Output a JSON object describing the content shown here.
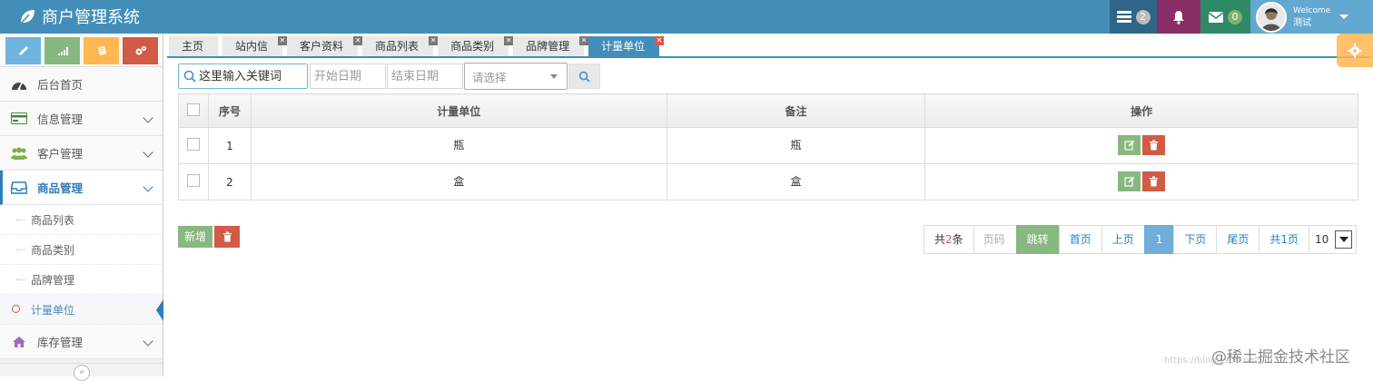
{
  "app": {
    "title": "商户管理系统"
  },
  "navbar": {
    "tasks_count": "2",
    "messages_count": "0",
    "user": {
      "greeting": "Welcome",
      "name": "测试"
    }
  },
  "sidebar": {
    "items": [
      {
        "label": "后台首页",
        "icon": "dashboard-icon"
      },
      {
        "label": "信息管理",
        "icon": "credit-card-icon"
      },
      {
        "label": "客户管理",
        "icon": "users-icon"
      },
      {
        "label": "商品管理",
        "icon": "inbox-icon"
      },
      {
        "label": "库存管理",
        "icon": "home-icon"
      }
    ],
    "subitems": [
      "商品列表",
      "商品类别",
      "品牌管理",
      "计量单位"
    ]
  },
  "tabs": [
    "主页",
    "站内信",
    "客户资料",
    "商品列表",
    "商品类别",
    "品牌管理",
    "计量单位"
  ],
  "search": {
    "keyword_placeholder": "这里输入关键词",
    "start_date_placeholder": "开始日期",
    "end_date_placeholder": "结束日期",
    "select_placeholder": "请选择"
  },
  "table": {
    "headers": {
      "index": "序号",
      "unit": "计量单位",
      "remark": "备注",
      "ops": "操作"
    },
    "rows": [
      {
        "index": "1",
        "unit": "瓶",
        "remark": "瓶"
      },
      {
        "index": "2",
        "unit": "盒",
        "remark": "盒"
      }
    ]
  },
  "actions": {
    "add_label": "新增"
  },
  "pager": {
    "total_prefix": "共",
    "total_count": "2",
    "total_suffix": "条",
    "page_placeholder": "页码",
    "jump": "跳转",
    "first": "首页",
    "prev": "上页",
    "current": "1",
    "next": "下页",
    "last": "尾页",
    "pages": "共1页",
    "page_size": "10"
  },
  "watermark": "@稀土掘金技术社区",
  "watermark_faint": "https://blog.csdn.net/"
}
